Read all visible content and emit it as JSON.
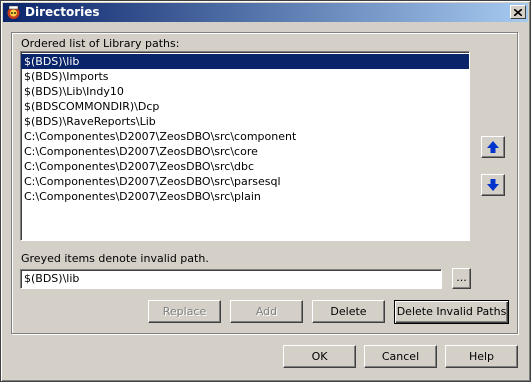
{
  "window": {
    "title": "Directories"
  },
  "library_label": "Ordered list of Library paths:",
  "paths": [
    "$(BDS)\\lib",
    "$(BDS)\\Imports",
    "$(BDS)\\Lib\\Indy10",
    "$(BDSCOMMONDIR)\\Dcp",
    "$(BDS)\\RaveReports\\Lib",
    "C:\\Componentes\\D2007\\ZeosDBO\\src\\component",
    "C:\\Componentes\\D2007\\ZeosDBO\\src\\core",
    "C:\\Componentes\\D2007\\ZeosDBO\\src\\dbc",
    "C:\\Componentes\\D2007\\ZeosDBO\\src\\parsesql",
    "C:\\Componentes\\D2007\\ZeosDBO\\src\\plain"
  ],
  "selected_index": 0,
  "invalid_note": "Greyed items denote invalid path.",
  "path_input": {
    "value": "$(BDS)\\lib"
  },
  "browse_label": "...",
  "buttons": {
    "replace": "Replace",
    "add": "Add",
    "delete": "Delete",
    "delete_invalid": "Delete Invalid Paths",
    "ok": "OK",
    "cancel": "Cancel",
    "help": "Help"
  },
  "icons": {
    "title": "delphi-app-icon",
    "move_up": "arrow-up-icon",
    "move_down": "arrow-down-icon",
    "close": "close-icon"
  },
  "colors": {
    "titlebar_start": "#0a246a",
    "titlebar_end": "#a6caf0",
    "selection": "#0a246a",
    "arrow": "#0033cc",
    "face": "#d4d0c8"
  }
}
